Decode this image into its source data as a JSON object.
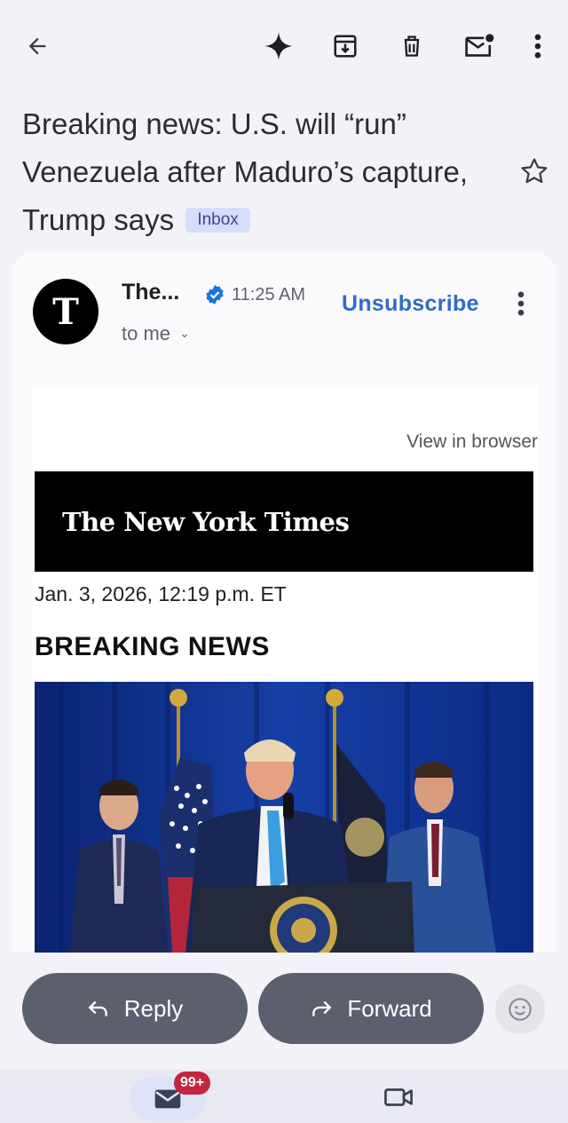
{
  "toolbar": {
    "icons": [
      "back-arrow-icon",
      "gemini-sparkle-icon",
      "archive-icon",
      "delete-icon",
      "mark-unread-icon",
      "more-vert-icon"
    ]
  },
  "email": {
    "subject": "Breaking news: U.S. will “run” Venezuela after Maduro’s capture, Trump says",
    "label": "Inbox",
    "sender": "The...",
    "avatar_letter": "T",
    "time": "11:25 AM",
    "recipient": "to me",
    "unsubscribe": "Unsubscribe"
  },
  "body": {
    "view_in_browser": "View in browser",
    "masthead": "The New York Times",
    "dateline": "Jan. 3, 2026, 12:19 p.m. ET",
    "headline": "BREAKING NEWS"
  },
  "actions": {
    "reply": "Reply",
    "forward": "Forward"
  },
  "nav": {
    "mail_badge": "99+"
  },
  "colors": {
    "accent_link": "#2f6bc6",
    "badge_red": "#c5243d",
    "inbox_badge": "#d6dcfb"
  }
}
